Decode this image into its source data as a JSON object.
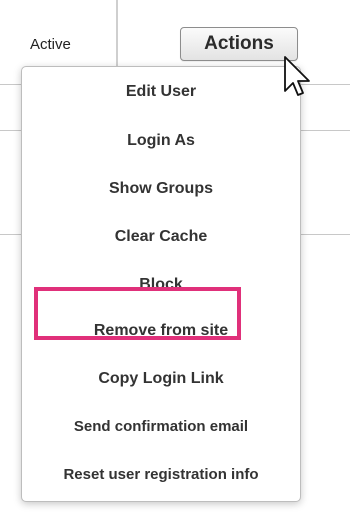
{
  "row": {
    "status": "Active"
  },
  "actions_button": {
    "label": "Actions"
  },
  "menu": {
    "items": [
      {
        "label": "Edit User"
      },
      {
        "label": "Login As"
      },
      {
        "label": "Show Groups"
      },
      {
        "label": "Clear Cache"
      },
      {
        "label": "Block"
      },
      {
        "label": "Remove from site"
      },
      {
        "label": "Copy Login Link"
      },
      {
        "label": "Send confirmation email"
      },
      {
        "label": "Reset user registration info"
      }
    ]
  },
  "colors": {
    "highlight": "#e0307a",
    "menu_text": "#333333"
  },
  "icons": {
    "cursor": "mouse-pointer-icon"
  }
}
